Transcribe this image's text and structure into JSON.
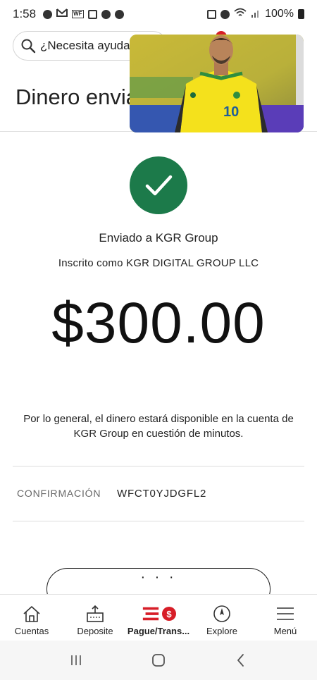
{
  "status_bar": {
    "time": "1:58",
    "battery": "100%"
  },
  "header": {
    "search_placeholder": "¿Necesita ayuda?",
    "title": "Dinero enviado"
  },
  "pip_video": {
    "jersey_number": "10"
  },
  "confirmation": {
    "sent_to": "Enviado a KGR Group",
    "enrolled_as": "Inscrito como KGR DIGITAL GROUP LLC",
    "amount": "$300.00",
    "availability_note": "Por lo general, el dinero estará disponible en la cuenta de KGR Group en cuestión de minutos.",
    "confirmation_label": "CONFIRMACIÓN",
    "confirmation_code": "WFCT0YJDGFL2",
    "action_button_label": "· · ·"
  },
  "bottom_nav": {
    "items": [
      {
        "label": "Cuentas",
        "icon": "house-icon"
      },
      {
        "label": "Deposite",
        "icon": "deposit-icon"
      },
      {
        "label": "Pague/Trans...",
        "icon": "pay-transfer-icon"
      },
      {
        "label": "Explore",
        "icon": "compass-icon"
      },
      {
        "label": "Menú",
        "icon": "menu-icon"
      }
    ],
    "active_index": 2
  },
  "colors": {
    "success_green": "#1c7a4a",
    "brand_red": "#d71e28"
  }
}
